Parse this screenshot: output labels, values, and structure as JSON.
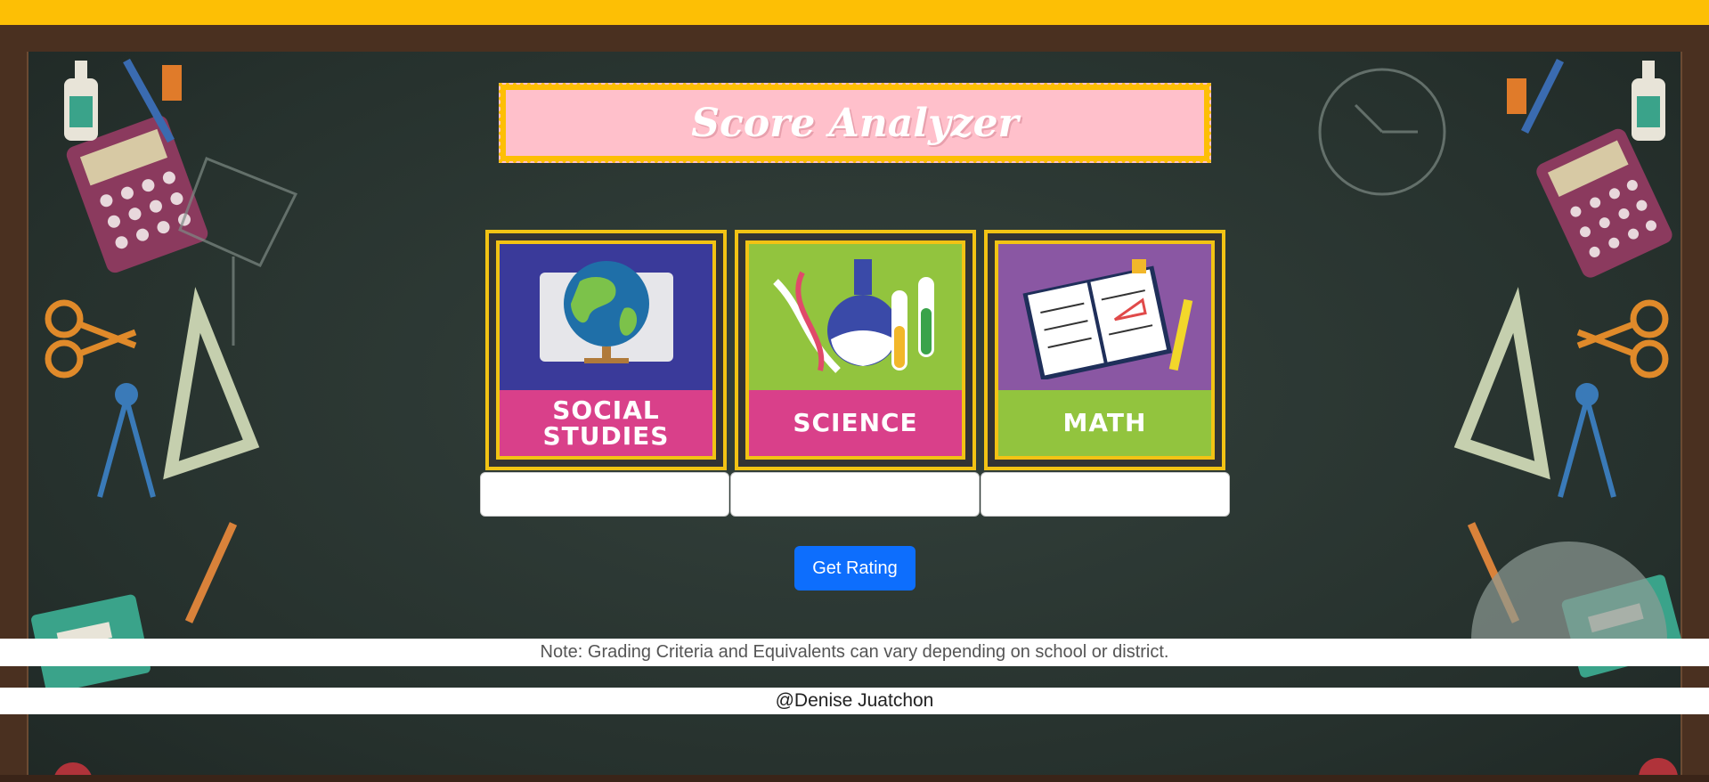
{
  "app": {
    "title": "Score Analyzer"
  },
  "subjects": [
    {
      "label_line1": "SOCIAL",
      "label_line2": "STUDIES",
      "icon": "globe-icon",
      "art_color": "#3a3a9a",
      "label_color": "#d9408a",
      "input_value": ""
    },
    {
      "label_line1": "SCIENCE",
      "label_line2": "",
      "icon": "flask-icon",
      "art_color": "#92c43e",
      "label_color": "#d9408a",
      "input_value": ""
    },
    {
      "label_line1": "MATH",
      "label_line2": "",
      "icon": "notebook-icon",
      "art_color": "#8a57a3",
      "label_color": "#92c43e",
      "input_value": ""
    }
  ],
  "actions": {
    "get_rating_label": "Get Rating"
  },
  "footer": {
    "note": "Note: Grading Criteria and Equivalents can vary depending on school or district.",
    "credit": "@Denise Juatchon"
  },
  "colors": {
    "top_bar": "#fdbf05",
    "banner_bg": "#ffc0cb",
    "banner_border": "#fdbf05",
    "button_bg": "#0d6efd"
  }
}
